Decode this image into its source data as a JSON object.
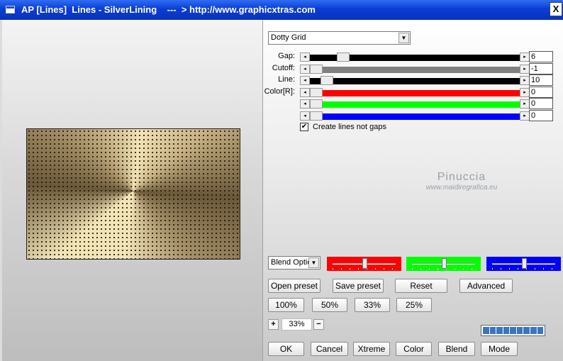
{
  "window": {
    "title": "AP [Lines]  Lines - SilverLining    ---  > http://www.graphicxtras.com",
    "close_label": "X"
  },
  "controls": {
    "mode_select": {
      "value": "Dotty Grid"
    },
    "sliders": [
      {
        "label": "Gap:",
        "value": "6",
        "track_color": "#000000",
        "position": 0.13
      },
      {
        "label": "Cutoff:",
        "value": "-1",
        "track_color": "#808080",
        "position": 0.0
      },
      {
        "label": "Line:",
        "value": "10",
        "track_color": "#000000",
        "position": 0.05
      },
      {
        "label": "Color[R]:",
        "value": "0",
        "track_color": "#ff0000",
        "position": 0.0
      },
      {
        "label": "",
        "value": "0",
        "track_color": "#00ff00",
        "position": 0.0
      },
      {
        "label": "",
        "value": "0",
        "track_color": "#0000ff",
        "position": 0.0
      }
    ],
    "checkbox": {
      "label": "Create lines not gaps",
      "checked": true,
      "mark": "✔"
    },
    "watermark": {
      "line1": "Pinuccia",
      "line2": "www.maidiregrafica.eu"
    },
    "blend_select": {
      "value": "Blend Optio"
    },
    "color_sliders": [
      {
        "color": "#ff0000",
        "level": 0.5
      },
      {
        "color": "#00ff00",
        "level": 0.5
      },
      {
        "color": "#0000ff",
        "level": 0.5
      }
    ],
    "preset_buttons": [
      "Open preset",
      "Save preset",
      "Reset",
      "Advanced"
    ],
    "zoom_buttons": [
      "100%",
      "50%",
      "33%",
      "25%"
    ],
    "zoom": {
      "minus": "−",
      "plus": "+",
      "value": "33%"
    },
    "progress": {
      "segments": 9
    },
    "bottom_buttons": [
      "OK",
      "Cancel",
      "Xtreme",
      "Color",
      "Blend",
      "Mode"
    ]
  }
}
